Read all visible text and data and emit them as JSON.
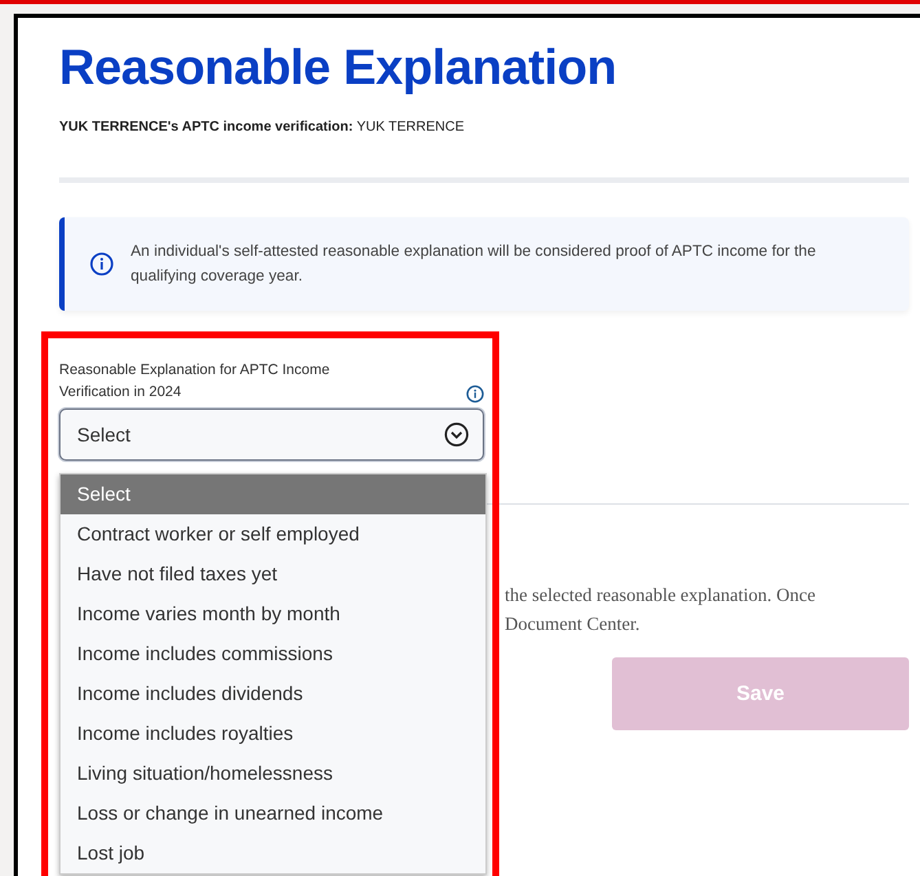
{
  "title": "Reasonable Explanation",
  "subtitle": {
    "label": "YUK TERRENCE's APTC income verification:",
    "value": "YUK TERRENCE"
  },
  "info_banner": {
    "text": "An individual's self-attested reasonable explanation will be considered proof of APTC income for the qualifying coverage year."
  },
  "field": {
    "label": "Reasonable Explanation for APTC Income Verification in 2024",
    "value": "Select",
    "expanded": true,
    "options": [
      {
        "label": "Select",
        "selected": true
      },
      {
        "label": "Contract worker or self employed",
        "selected": false
      },
      {
        "label": "Have not filed taxes yet",
        "selected": false
      },
      {
        "label": "Income varies month by month",
        "selected": false
      },
      {
        "label": "Income includes commissions",
        "selected": false
      },
      {
        "label": "Income includes dividends",
        "selected": false
      },
      {
        "label": "Income includes royalties",
        "selected": false
      },
      {
        "label": "Living situation/homelessness",
        "selected": false
      },
      {
        "label": "Loss or change in unearned income",
        "selected": false
      },
      {
        "label": "Lost job",
        "selected": false
      }
    ]
  },
  "note_lines": [
    "the selected reasonable explanation. Once",
    "Document Center."
  ],
  "save_button": {
    "label": "Save",
    "disabled": true
  }
}
